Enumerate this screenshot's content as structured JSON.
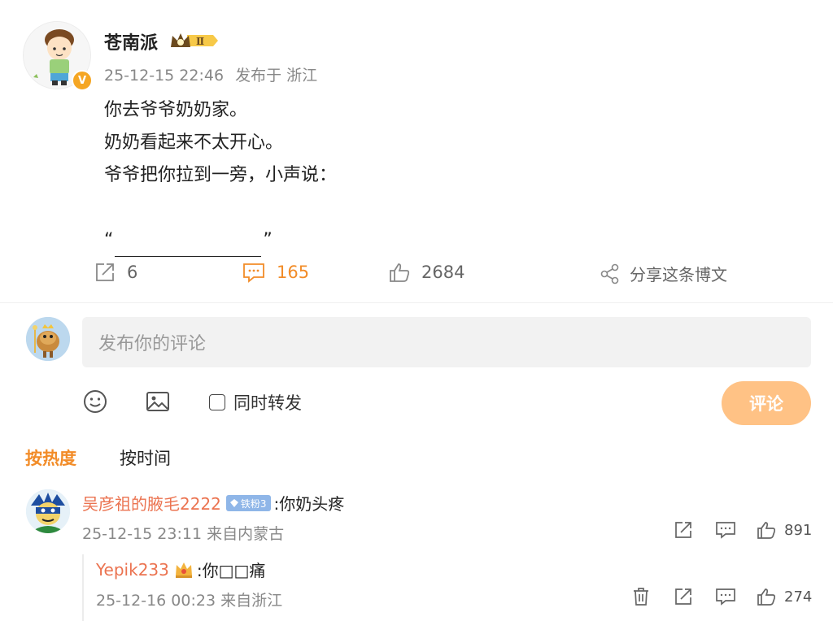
{
  "post": {
    "author": "苍南派",
    "verified_badge": "V",
    "vip_level": "Ⅱ",
    "date": "25-12-15 22:46",
    "location": "发布于 浙江",
    "lines": [
      "你去爷爷奶奶家。",
      "奶奶看起来不太开心。",
      "爷爷把你拉到一旁，小声说："
    ],
    "quote_open": "“",
    "quote_close": "”",
    "actions": {
      "repost_count": "6",
      "comment_count": "165",
      "like_count": "2684",
      "share_label": "分享这条博文"
    }
  },
  "composer": {
    "placeholder": "发布你的评论",
    "repost_checkbox_label": "同时转发",
    "submit_label": "评论"
  },
  "sort_tabs": {
    "hot": "按热度",
    "time": "按时间"
  },
  "comments": [
    {
      "author": "吴彦祖的腋毛2222",
      "fan_badge": "铁粉3",
      "text": ":你奶头疼",
      "date": "25-12-15 23:11",
      "location": "来自内蒙古",
      "likes": "891"
    }
  ],
  "replies": [
    {
      "author": "Yepik233",
      "text": ":你□□痛",
      "date": "25-12-16 00:23",
      "location": "来自浙江",
      "likes": "274"
    }
  ],
  "colors": {
    "accent": "#f28c28",
    "name": "#eb7350",
    "button": "#ffc285"
  }
}
